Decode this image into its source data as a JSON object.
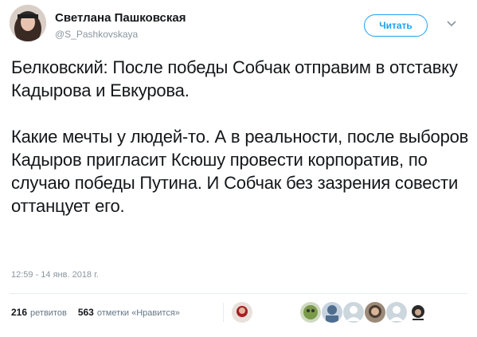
{
  "user": {
    "name": "Светлана Пашковская",
    "handle": "@S_Pashkovskaya"
  },
  "follow_button": {
    "label": "Читать"
  },
  "tweet": {
    "paragraphs": [
      "Белковский: После победы Собчак отправим в отставку Кадырова и Евкурова.",
      "Какие мечты у людей-то. А в реальности, после выборов Кадыров пригласит Ксюшу провести корпоратив, по случаю победы Путина. И Собчак без зазрения совести оттанцует его."
    ],
    "timestamp": "12:59 - 14 янв. 2018 г."
  },
  "stats": {
    "retweets_count": "216",
    "retweets_label": "ретвитов",
    "likes_count": "563",
    "likes_label": "отметки «Нравится»"
  },
  "colors": {
    "accent": "#1da1f2",
    "muted": "#8a959e",
    "divider": "#e6ecf0"
  },
  "icons": {
    "caret": "chevron-down-icon"
  }
}
